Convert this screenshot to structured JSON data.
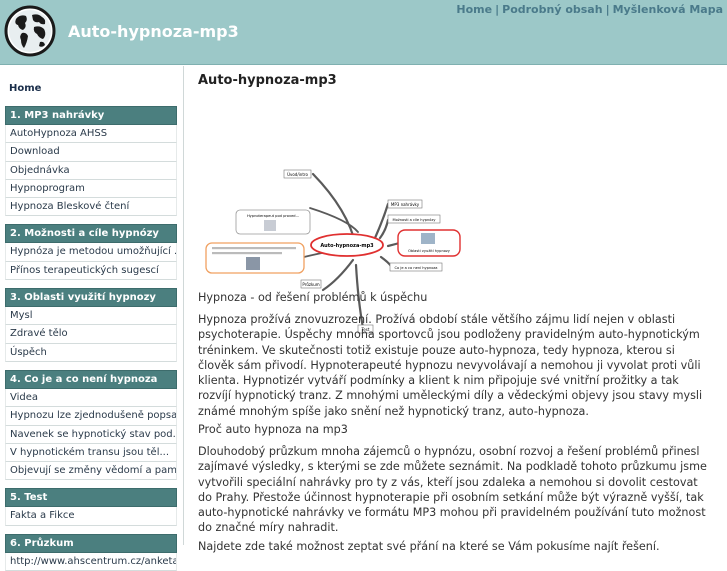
{
  "header": {
    "title": "Auto-hypnoza-mp3",
    "links": [
      "Home",
      "Podrobný obsah",
      "Myšlenková Mapa"
    ]
  },
  "sidebar": {
    "home": "Home",
    "sections": [
      {
        "title": "1. MP3 nahrávky",
        "items": [
          "AutoHypnoza AHSS",
          "Download",
          "Objednávka",
          "Hypnoprogram",
          "Hypnoza Bleskové čtení"
        ]
      },
      {
        "title": "2. Možnosti a cíle hypnózy",
        "items": [
          "Hypnóza je metodou umožňující ...",
          "Přínos terapeutických sugescí"
        ]
      },
      {
        "title": "3. Oblasti využití hypnozy",
        "items": [
          "Mysl",
          "Zdravé tělo",
          "Úspěch"
        ]
      },
      {
        "title": "4. Co je a co není hypnoza",
        "items": [
          "Videa",
          "Hypnozu lze zjednodušeně popsa...",
          "Navenek se hypnotický stav pod...",
          "V hypnotickém transu jsou těl...",
          "Objevují se změny vědomí a pam..."
        ]
      },
      {
        "title": "5. Test",
        "items": [
          "Fakta a Fikce"
        ]
      },
      {
        "title": "6. Průzkum",
        "items": [
          "http://www.ahscentrum.cz/anketa..."
        ]
      }
    ]
  },
  "main": {
    "title": "Auto-hypnoza-mp3",
    "mindmap": {
      "center": "Auto-hypnoza-mp3",
      "nodes": [
        "Úvod/intro",
        "MP3 nahrávky",
        "Možnosti a cíle hypnózy",
        "Oblasti využití hypnozy",
        "Co je a co není hypnoza",
        "Průzkum",
        "Test",
        "Hypnoterapeut pod proved..."
      ]
    },
    "paragraphs": [
      "Hypnoza - od řešení problémů k úspěchu",
      "Hypnoza prožívá znovuzrození. Prožívá období stále většího zájmu lidí nejen v oblasti psychoterapie. Úspěchy mnoha sportovců jsou podloženy pravidelným auto-hypnotickým tréninkem. Ve skutečnosti totiž existuje pouze auto-hypnoza, tedy hypnoza, kterou si člověk  sám přivodí.  Hypnoterapeuté hypnozu nevyvolávají a nemohou ji vyvolat proti vůli klienta. Hypnotizér vytváří podmínky a klient k nim připojuje své vnitřní prožitky a tak rozvíjí hypnotický tranz. Z mnohými uměleckými díly a vědeckými objevy jsou stavy mysli známé mnohým spíše jako snění než hypnotický tranz, auto-hypnoza.",
      "Proč auto hypnoza na mp3",
      "Dlouhodobý průzkum mnoha zájemců o hypnózu, osobní rozvoj a řešení problémů přinesl zajímavé výsledky, s kterými se zde můžete seznámit. Na podkladě tohoto průzkumu jsme vytvořili speciální nahrávky pro ty z vás, kteří jsou zdaleka a nemohou si dovolit cestovat do Prahy. Přestože účinnost hypnoterapie při osobním setkání může být výrazně vyšší, tak auto-hypnotické nahrávky ve formátu MP3 mohou při pravidelném používání tuto možnost do značné míry nahradit.",
      "Najdete zde také možnost zeptat své přání na které se Vám pokusíme najít řešení."
    ]
  },
  "colors": {
    "header": "#9cc8c8",
    "section": "#4b7f7f",
    "node_highlight": "#e03030",
    "node_orange": "#f0a060"
  }
}
